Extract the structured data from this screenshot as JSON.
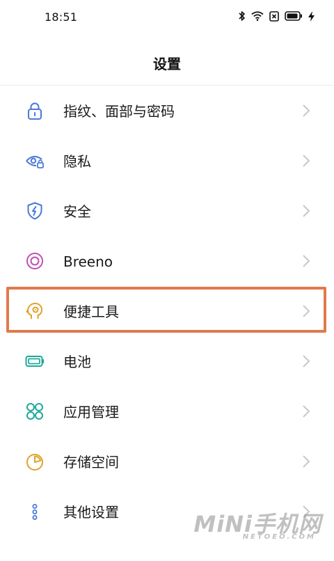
{
  "status_bar": {
    "time": "18:51",
    "icons": [
      "bluetooth-icon",
      "wifi-icon",
      "sim-off-icon",
      "battery-icon",
      "charging-icon"
    ]
  },
  "header": {
    "title": "设置"
  },
  "settings": {
    "items": [
      {
        "label": "指纹、面部与密码",
        "icon": "lock-icon",
        "color": "#4a79d9"
      },
      {
        "label": "隐私",
        "icon": "privacy-eye-icon",
        "color": "#4a79d9"
      },
      {
        "label": "安全",
        "icon": "shield-bolt-icon",
        "color": "#4a79d9"
      },
      {
        "label": "Breeno",
        "icon": "breeno-ring-icon",
        "color": "#c24fb0"
      },
      {
        "label": "便捷工具",
        "icon": "head-gear-icon",
        "color": "#e0a22a"
      },
      {
        "label": "电池",
        "icon": "battery-outline-icon",
        "color": "#1fa89a"
      },
      {
        "label": "应用管理",
        "icon": "apps-grid-icon",
        "color": "#1fa89a"
      },
      {
        "label": "存储空间",
        "icon": "storage-pie-icon",
        "color": "#e0a22a"
      },
      {
        "label": "其他设置",
        "icon": "more-dots-icon",
        "color": "#4a79d9"
      }
    ],
    "highlighted_item": "便捷工具"
  },
  "highlight_color": "#e07a4a",
  "watermark": {
    "text": "MiNi手机网",
    "sub": "NETOEO.COM"
  }
}
